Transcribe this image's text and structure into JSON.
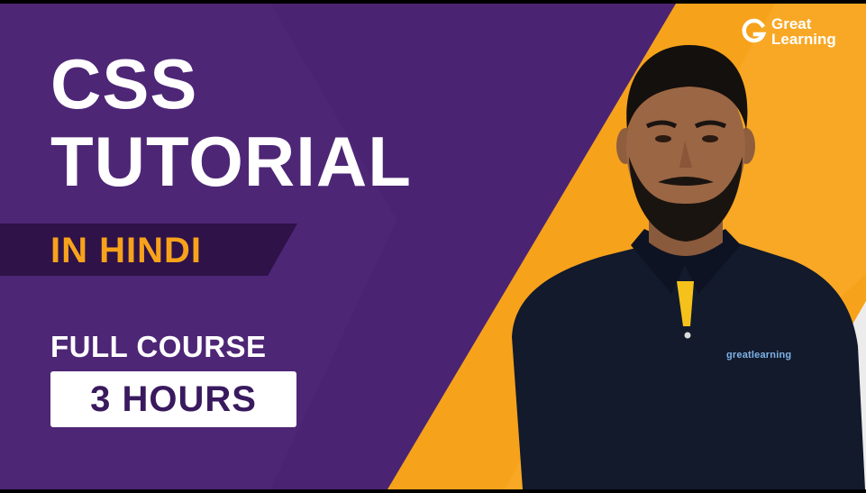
{
  "thumbnail": {
    "title_line1": "CSS",
    "title_line2": "TUTORIAL",
    "subtitle": "IN HINDI",
    "course_label": "FULL COURSE",
    "duration_badge": "3 HOURS",
    "logo": {
      "line1": "Great",
      "line2": "Learning"
    },
    "shirt_brand": "greatlearning"
  },
  "colors": {
    "purple": "#4a2472",
    "dark_purple": "#2e1248",
    "orange": "#f7a21b",
    "white": "#ffffff",
    "navy_shirt": "#121a2c"
  },
  "icons": [
    "great-learning-logo-icon",
    "presenter-photo"
  ]
}
